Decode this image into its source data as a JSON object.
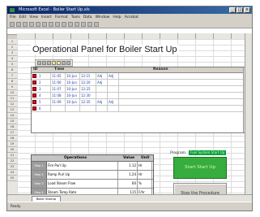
{
  "window": {
    "title": "Microsoft Excel - Boiler Start Up.xls",
    "controls": [
      "_",
      "□",
      "×"
    ]
  },
  "menu": [
    "File",
    "Edit",
    "View",
    "Insert",
    "Format",
    "Tools",
    "Data",
    "Window",
    "Help",
    "Acrobat"
  ],
  "colors": {
    "accent_green": "#36ad3e",
    "badge_green": "#00a050",
    "checkbox_red": "#c8102e"
  },
  "panel": {
    "title": "Operational Panel for Boiler Start Up",
    "grid": {
      "headers": [
        "ID",
        "Time",
        "Reason"
      ],
      "rows": [
        [
          "1",
          "11:05",
          "10-Jun",
          "12:15",
          "Adj",
          "Adj"
        ],
        [
          "2",
          "11:06",
          "10-Jun",
          "12:20",
          "Adj",
          ""
        ],
        [
          "3",
          "11:07",
          "10-Jun",
          "12:25",
          "",
          ""
        ],
        [
          "4",
          "11:08",
          "10-Jun",
          "12:30",
          "",
          ""
        ],
        [
          "5",
          "11:09",
          "10-Jun",
          "12:35",
          "Adj",
          "Adj"
        ],
        [
          "6",
          "",
          "",
          "",
          "",
          ""
        ]
      ]
    },
    "table": {
      "headers": [
        "Operations",
        "Value",
        "Unit"
      ],
      "rows": [
        {
          "label": "Step 1",
          "op": "Fire Purl Up",
          "value": "1.12",
          "unit": "Hr"
        },
        {
          "label": "Step 2",
          "op": "Ramp Purl Up",
          "value": "1.24",
          "unit": "Hr"
        },
        {
          "label": "Step 3",
          "op": "Load Steam Flow",
          "value": "60",
          "unit": "%"
        },
        {
          "label": "Step 4",
          "op": "Steam Temp Rate",
          "value": "115",
          "unit": "F/hr"
        }
      ]
    },
    "progress": {
      "label": "Program",
      "status": "Fuel System Start Up"
    },
    "buttons": {
      "start": "Start Start Up",
      "stop": "Stop the Procedure"
    }
  },
  "sheet": {
    "tab": "Boiler Startup",
    "status": "Ready"
  }
}
